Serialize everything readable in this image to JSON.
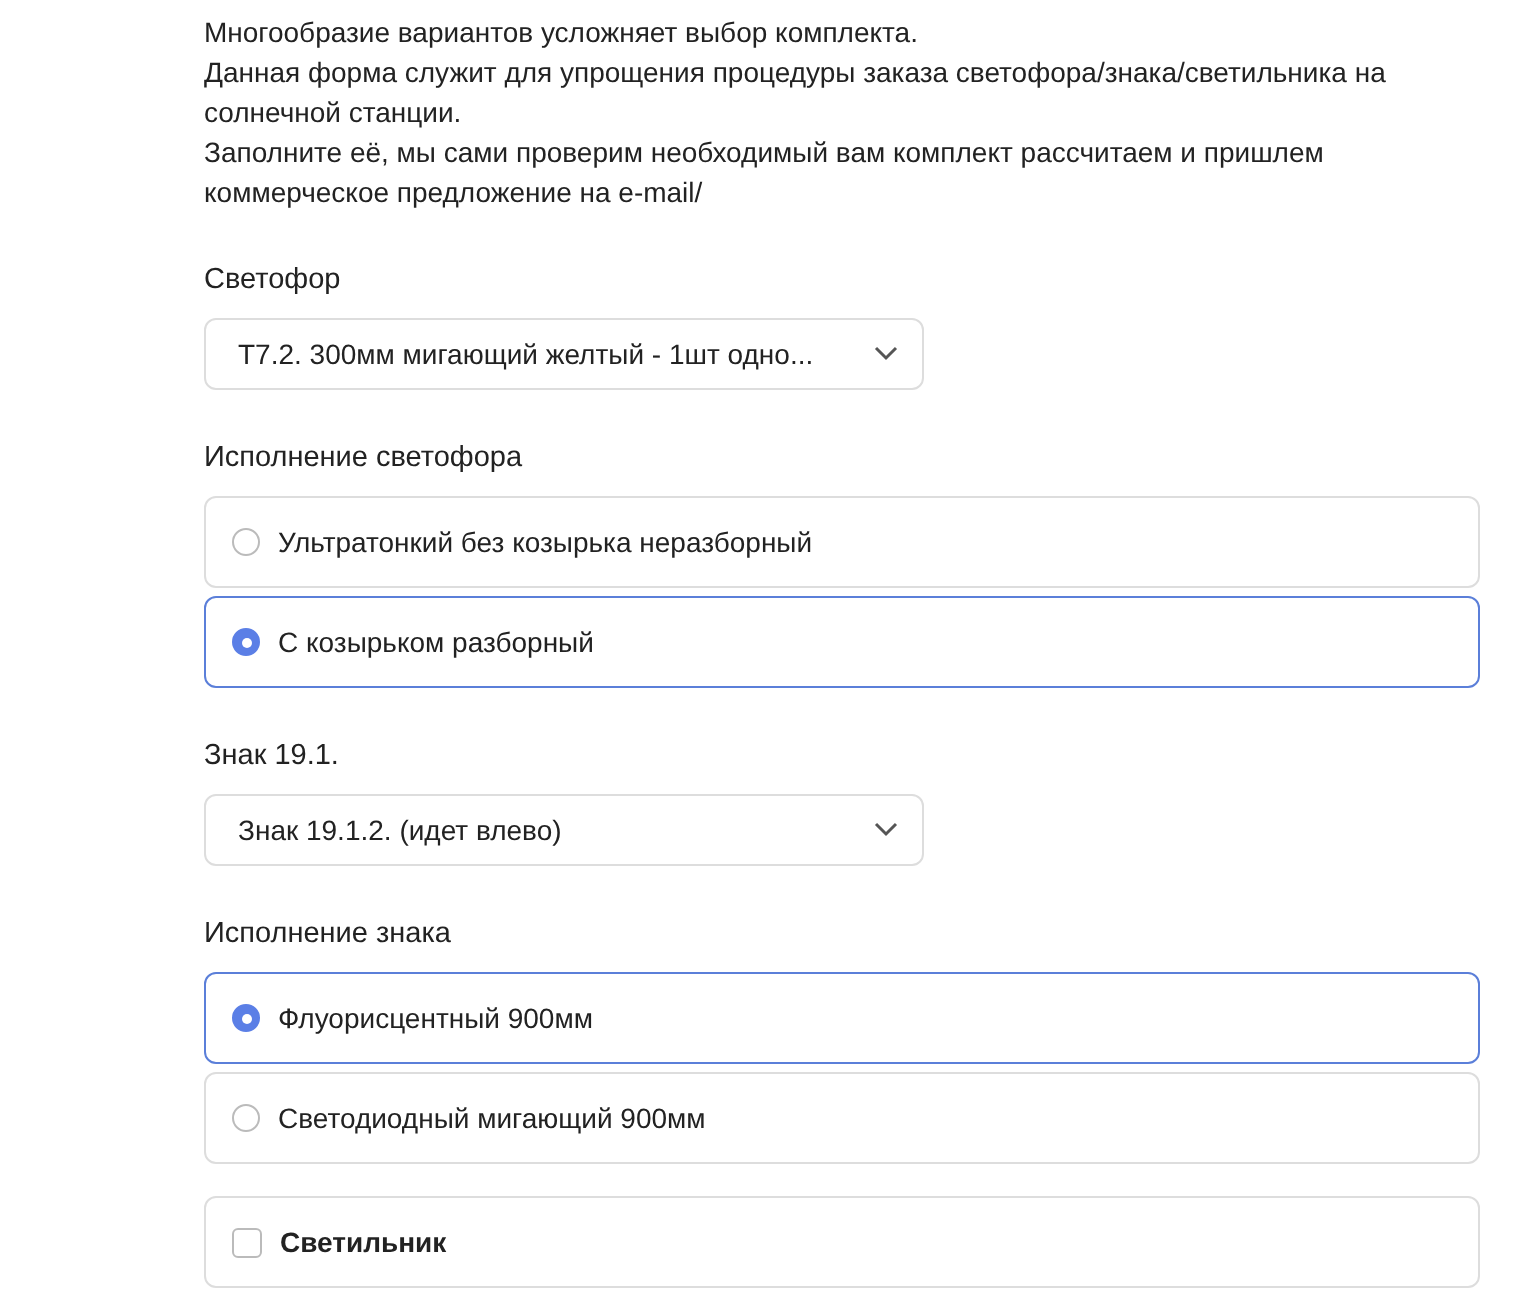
{
  "intro": [
    "Многообразие вариантов усложняет выбор комплекта.",
    "Данная форма служит для упрощения процедуры заказа светофора/знака/светильника на солнечной станции.",
    "Заполните её, мы сами проверим необходимый вам комплект рассчитаем и пришлем коммерческое предложение на e-mail/"
  ],
  "fields": [
    {
      "kind": "select",
      "label": "Светофор",
      "value": "Т7.2. 300мм мигающий желтый - 1шт одно..."
    },
    {
      "kind": "radio",
      "label": "Исполнение светофора",
      "options": [
        {
          "label": "Ультратонкий без козырька неразборный",
          "selected": false
        },
        {
          "label": "С козырьком разборный",
          "selected": true
        }
      ]
    },
    {
      "kind": "select",
      "label": "Знак 19.1.",
      "value": "Знак 19.1.2. (идет влево)"
    },
    {
      "kind": "radio",
      "label": "Исполнение знака",
      "options": [
        {
          "label": "Флуорисцентный 900мм",
          "selected": true
        },
        {
          "label": "Светодиодный мигающий 900мм",
          "selected": false
        }
      ]
    },
    {
      "kind": "checkbox",
      "label": "Светильник",
      "checked": false
    }
  ]
}
